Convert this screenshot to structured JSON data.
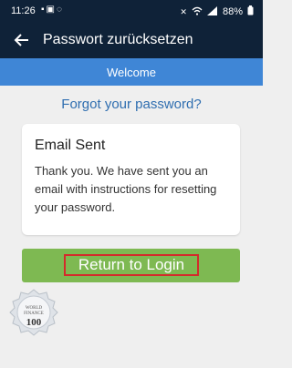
{
  "status_bar": {
    "time": "11:26",
    "battery": "88%",
    "left_icons": [
      "notification-icon",
      "photo-icon",
      "whatsapp-icon"
    ],
    "right_icons": [
      "mute-icon",
      "wifi-icon",
      "signal-icon",
      "battery-icon"
    ]
  },
  "app_bar": {
    "title": "Passwort zurücksetzen",
    "back_icon": "back-arrow-icon"
  },
  "banner": {
    "label": "Welcome"
  },
  "forgot_link": "Forgot your password?",
  "card": {
    "heading": "Email Sent",
    "body": "Thank you. We have sent you an email with instructions for resetting your password."
  },
  "login_button": {
    "label": "Return to Login"
  },
  "seal": {
    "line1": "WORLD",
    "line2": "FINANCE",
    "line3": "100"
  },
  "colors": {
    "header_bg": "#0f2238",
    "banner_bg": "#3f86d6",
    "link": "#2f6eb0",
    "button_bg": "#7eb952",
    "highlight_border": "#d32b2b"
  }
}
